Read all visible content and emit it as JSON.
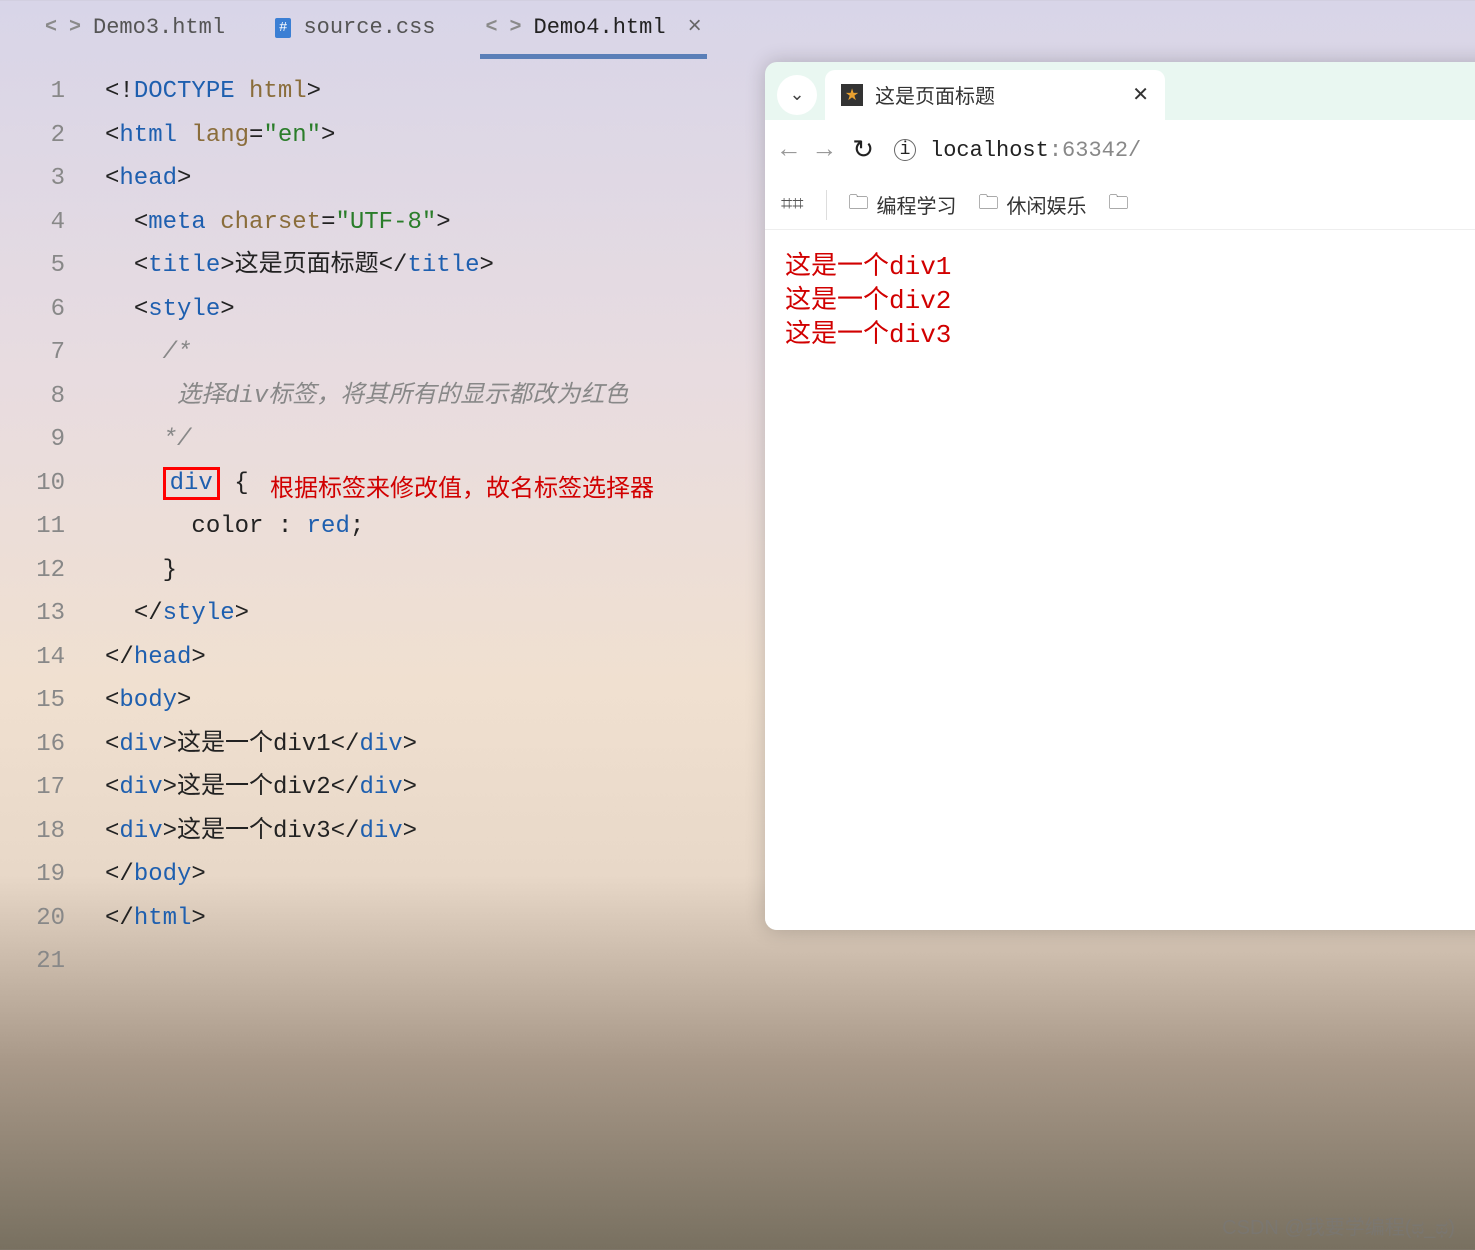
{
  "tabs": [
    {
      "label": "Demo3.html",
      "type": "html"
    },
    {
      "label": "source.css",
      "type": "css"
    },
    {
      "label": "Demo4.html",
      "type": "html",
      "active": true
    }
  ],
  "lines": [
    "1",
    "2",
    "3",
    "4",
    "5",
    "6",
    "7",
    "8",
    "9",
    "10",
    "11",
    "12",
    "13",
    "14",
    "15",
    "16",
    "17",
    "18",
    "19",
    "20",
    "21"
  ],
  "code": {
    "l1": {
      "prefix": "<!",
      "tag": "DOCTYPE ",
      "attr": "html",
      "suffix": ">"
    },
    "l2": {
      "open": "<",
      "tag": "html ",
      "attr": "lang",
      "eq": "=",
      "str": "\"en\"",
      "close": ">"
    },
    "l3": {
      "open": "<",
      "tag": "head",
      "close": ">"
    },
    "l4": {
      "open": "<",
      "tag": "meta ",
      "attr": "charset",
      "eq": "=",
      "str": "\"UTF-8\"",
      "close": ">"
    },
    "l5": {
      "open1": "<",
      "tag": "title",
      "close1": ">",
      "text": "这是页面标题",
      "open2": "</",
      "close2": ">"
    },
    "l6": {
      "open": "<",
      "tag": "style",
      "close": ">"
    },
    "l7": "/*",
    "l8": "选择div标签，将其所有的显示都改为红色",
    "l9": "*/",
    "l10": {
      "sel": "div",
      "brace": " {"
    },
    "l11": {
      "prop": "color ",
      "colon": ": ",
      "val": "red",
      "semi": ";"
    },
    "l12": "}",
    "l13": {
      "open": "</",
      "tag": "style",
      "close": ">"
    },
    "l14": {
      "open": "</",
      "tag": "head",
      "close": ">"
    },
    "l15": {
      "open": "<",
      "tag": "body",
      "close": ">"
    },
    "l16": {
      "open1": "<",
      "tag": "div",
      "close1": ">",
      "text": "这是一个div1",
      "open2": "</",
      "close2": ">"
    },
    "l17": {
      "open1": "<",
      "tag": "div",
      "close1": ">",
      "text": "这是一个div2",
      "open2": "</",
      "close2": ">"
    },
    "l18": {
      "open1": "<",
      "tag": "div",
      "close1": ">",
      "text": "这是一个div3",
      "open2": "</",
      "close2": ">"
    },
    "l19": {
      "open": "</",
      "tag": "body",
      "close": ">"
    },
    "l20": {
      "open": "</",
      "tag": "html",
      "close": ">"
    }
  },
  "annotation": "根据标签来修改值，故名标签选择器",
  "browser": {
    "tab_title": "这是页面标题",
    "url_host": "localhost",
    "url_rest": ":63342/",
    "bookmarks": [
      "编程学习",
      "休闲娱乐"
    ],
    "content": [
      "这是一个div1",
      "这是一个div2",
      "这是一个div3"
    ]
  },
  "watermark": "CSDN @我要学编程(ಥ_ಥ)"
}
